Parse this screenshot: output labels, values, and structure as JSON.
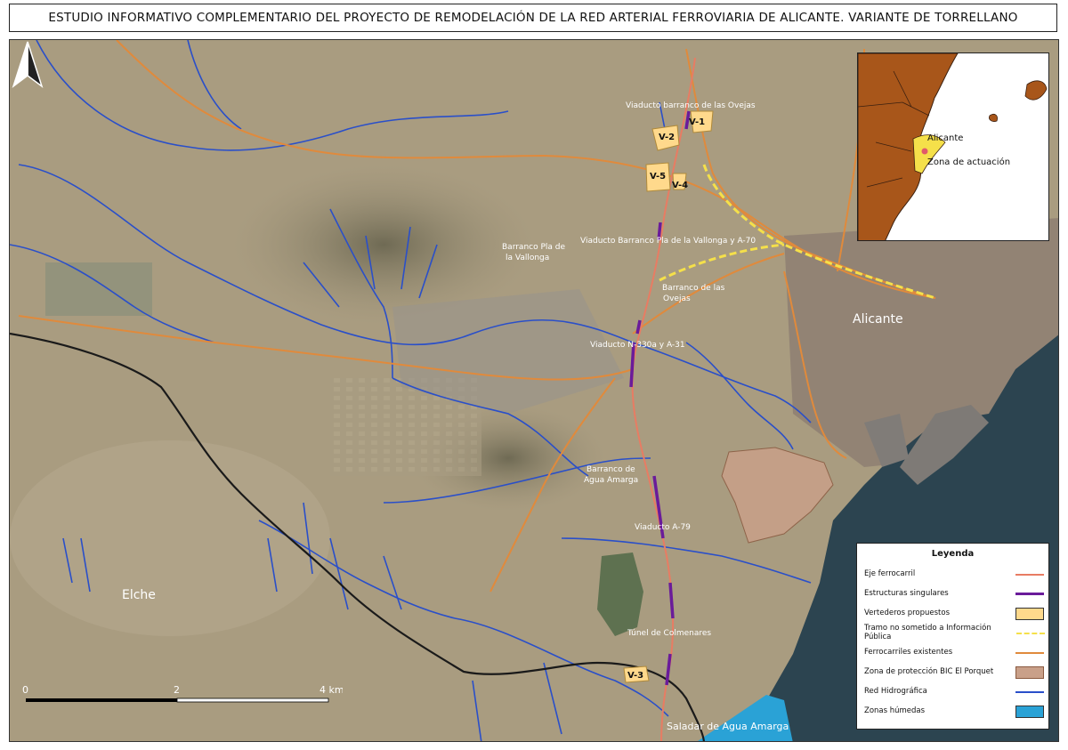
{
  "title": "ESTUDIO INFORMATIVO COMPLEMENTARIO DEL PROYECTO DE REMODELACIÓN DE LA RED ARTERIAL FERROVIARIA DE ALICANTE. VARIANTE DE TORRELLANO",
  "map": {
    "labels": {
      "viaducto_ovejas": "Viaducto barranco de las Ovejas",
      "v1": "V-1",
      "v2": "V-2",
      "v3": "V-3",
      "v4": "V-4",
      "v5": "V-5",
      "barranco_pla": "Barranco Pla de",
      "barranco_pla2": "la Vallonga",
      "viaducto_pla": "Viaducto Barranco Pla de la Vallonga y A-70",
      "barranco_ovejas": "Barranco de las",
      "barranco_ovejas2": "Ovejas",
      "alicante": "Alicante",
      "viaducto_n330": "Viaducto N-330a y A-31",
      "barranco_agua": "Barranco de",
      "barranco_agua2": "Agua Amarga",
      "viaducto_a79": "Viaducto A-79",
      "elche": "Elche",
      "tunel": "Túnel de Colmenares",
      "saladar": "Saladar de Agua Amarga"
    },
    "inset": {
      "city": "Alicante",
      "zone": "Zona de actuación"
    },
    "scale": {
      "ticks": [
        "0",
        "2",
        "4 km"
      ]
    }
  },
  "legend": {
    "title": "Leyenda",
    "items": [
      {
        "label": "Eje ferrocarril",
        "color": "#e87c63"
      },
      {
        "label": "Estructuras singulares",
        "color": "#6a1b9a"
      },
      {
        "label": "Vertederos propuestos",
        "color": "#ffd98c"
      },
      {
        "label": "Tramo no sometido a Información Pública",
        "color": "#f5e04a"
      },
      {
        "label": "Ferrocarriles existentes",
        "color": "#e08a3c"
      },
      {
        "label": "Zona de protección BIC El Porquet",
        "color": "#c9a089"
      },
      {
        "label": "Red Hidrográfica",
        "color": "#2a4fc9"
      },
      {
        "label": "Zonas húmedas",
        "color": "#2aa2d6"
      }
    ]
  }
}
